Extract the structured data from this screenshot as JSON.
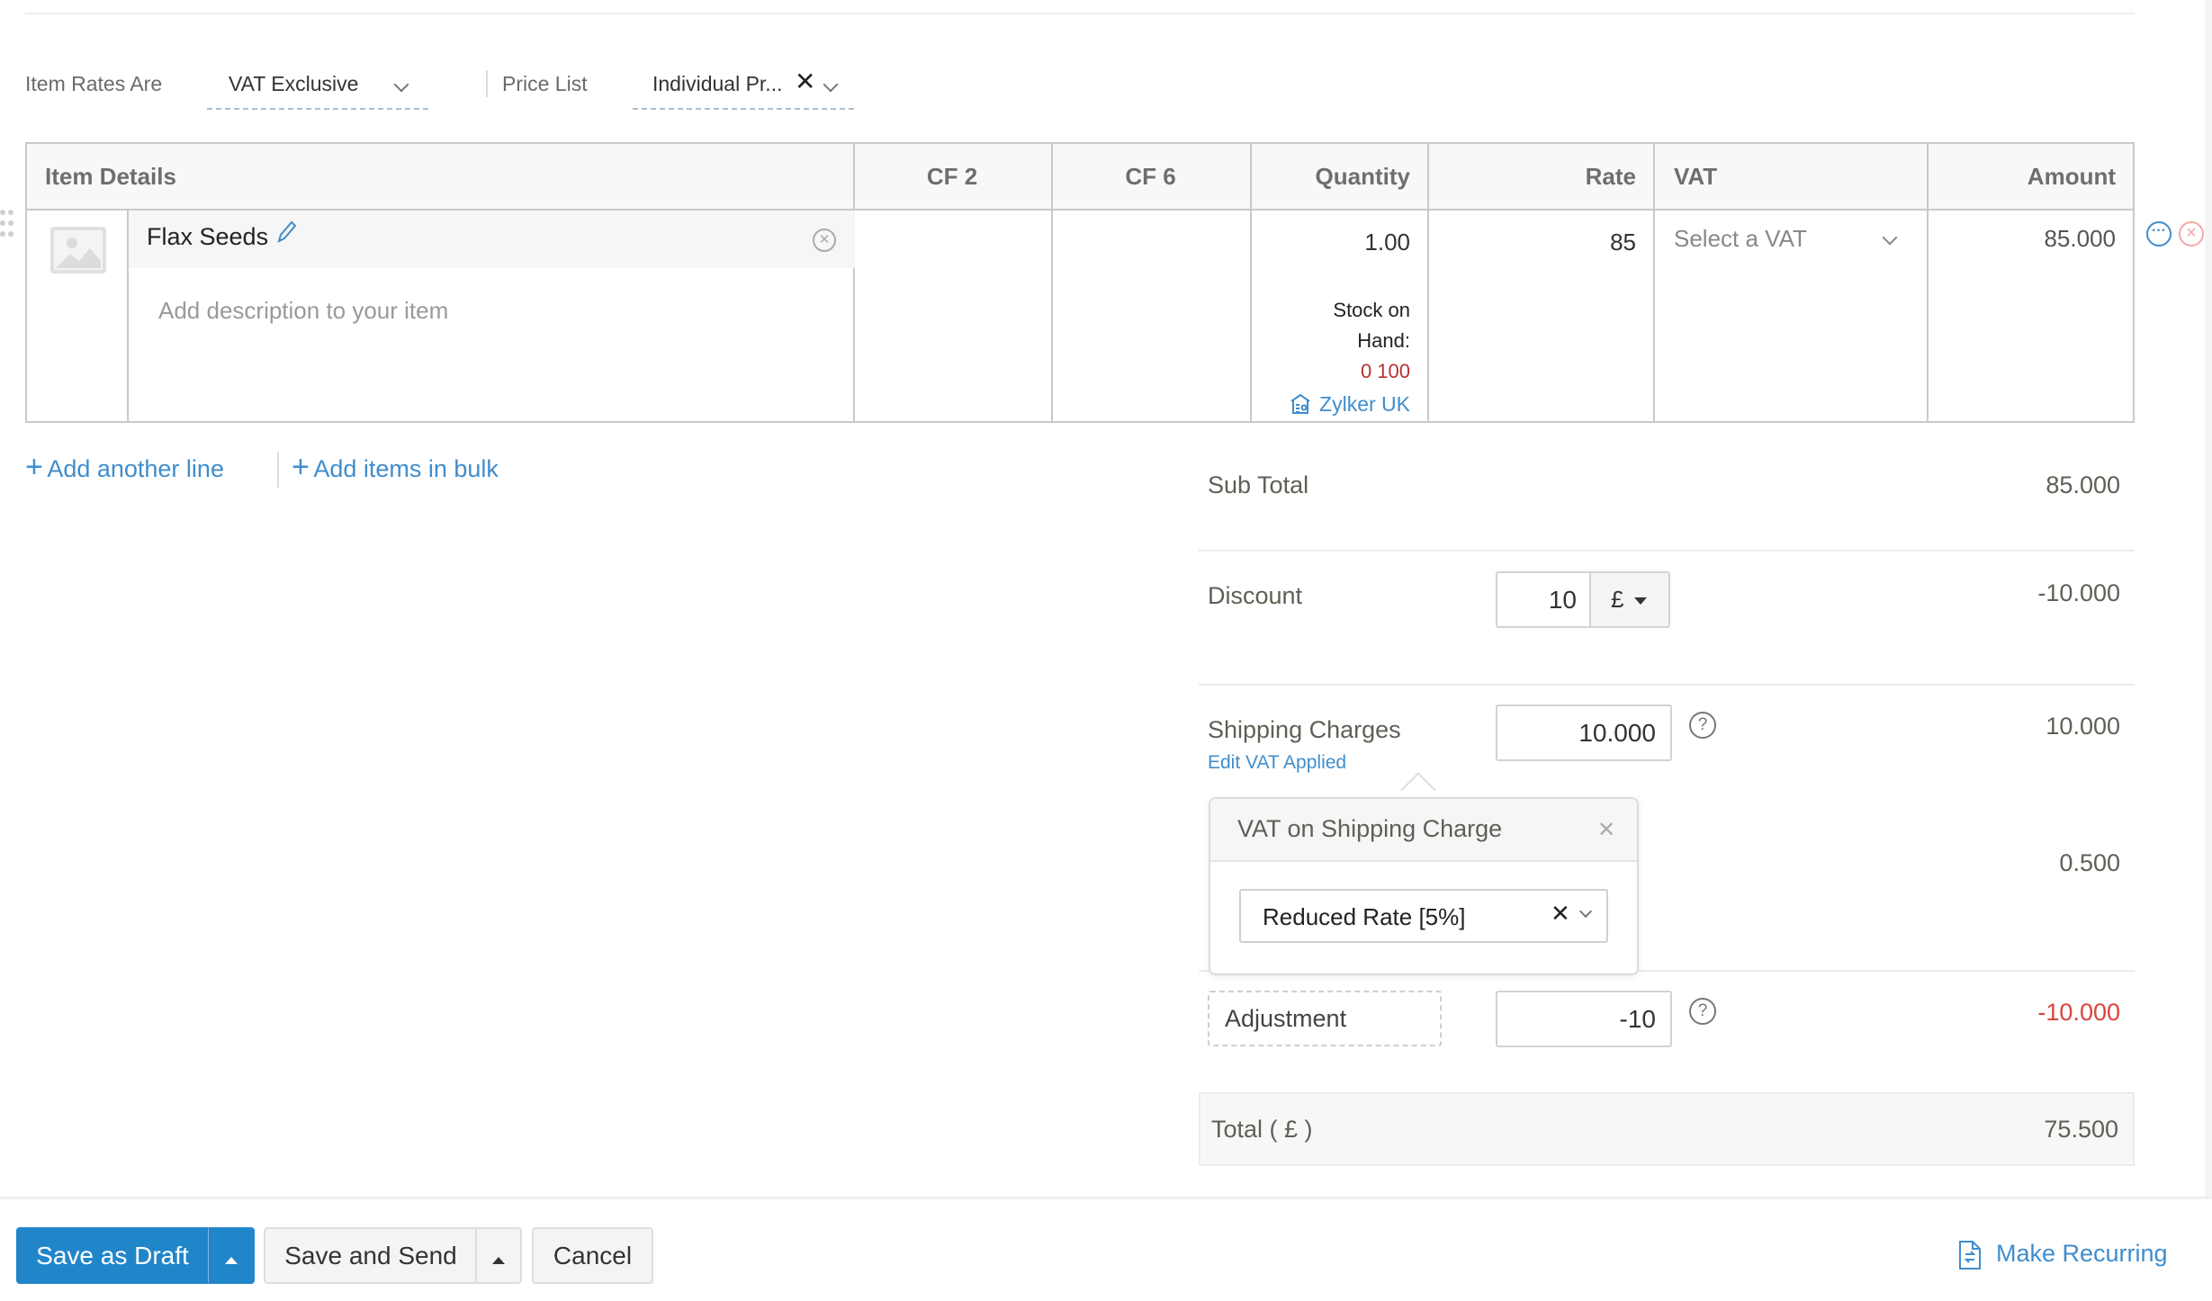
{
  "rates_bar": {
    "item_rates_label": "Item Rates Are",
    "item_rates_value": "VAT Exclusive",
    "price_list_label": "Price List",
    "price_list_value": "Individual Pr..."
  },
  "table": {
    "headers": [
      "Item Details",
      "CF 2",
      "CF 6",
      "Quantity",
      "Rate",
      "VAT",
      "Amount"
    ],
    "rows": [
      {
        "item_name": "Flax Seeds",
        "description_placeholder": "Add description to your item",
        "cf2": "",
        "cf6": "",
        "quantity": "1.00",
        "stock_label_1": "Stock on",
        "stock_label_2": "Hand:",
        "stock_value": "0 100",
        "warehouse": "Zylker UK",
        "rate": "85",
        "vat_placeholder": "Select a VAT",
        "amount": "85.000"
      }
    ]
  },
  "actions": {
    "add_line": "Add another line",
    "add_bulk": "Add items in bulk"
  },
  "totals": {
    "sub_total_label": "Sub Total",
    "sub_total_value": "85.000",
    "discount_label": "Discount",
    "discount_input": "10",
    "discount_unit": "£",
    "discount_value": "-10.000",
    "shipping_label": "Shipping Charges",
    "shipping_edit_vat": "Edit VAT Applied",
    "shipping_input": "10.000",
    "shipping_value": "10.000",
    "vat_value": "0.500",
    "adjustment_label": "Adjustment",
    "adjustment_input": "-10",
    "adjustment_value": "-10.000",
    "total_label": "Total ( £ )",
    "total_value": "75.500"
  },
  "popover": {
    "title": "VAT on Shipping Charge",
    "selected": "Reduced Rate [5%]"
  },
  "footer": {
    "save_draft": "Save as Draft",
    "save_send": "Save and Send",
    "cancel": "Cancel",
    "make_recurring": "Make Recurring"
  },
  "colors": {
    "accent": "#2186c9",
    "link": "#408dcc",
    "negative": "#d9453d",
    "stock_red": "#b8312f"
  }
}
